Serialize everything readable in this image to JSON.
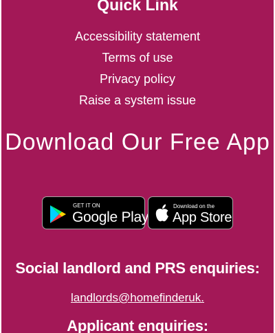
{
  "quick_link": {
    "title": "Quick Link",
    "items": [
      {
        "label": "Accessibility statement"
      },
      {
        "label": "Terms of use"
      },
      {
        "label": "Privacy policy"
      },
      {
        "label": "Raise a system issue"
      }
    ]
  },
  "download": {
    "title": "Download Our Free App",
    "google_play": {
      "small": "GET IT ON",
      "big": "Google Play",
      "icon": "google-play-icon"
    },
    "app_store": {
      "small": "Download on the",
      "big": "App Store",
      "icon": "apple-icon"
    }
  },
  "social": {
    "title": "Social landlord and PRS enquiries:",
    "email": "landlords@homefinderuk."
  },
  "applicant": {
    "title": "Applicant enquiries:"
  },
  "colors": {
    "background": "#a31857",
    "text": "#ffffff",
    "badge": "#000000"
  }
}
